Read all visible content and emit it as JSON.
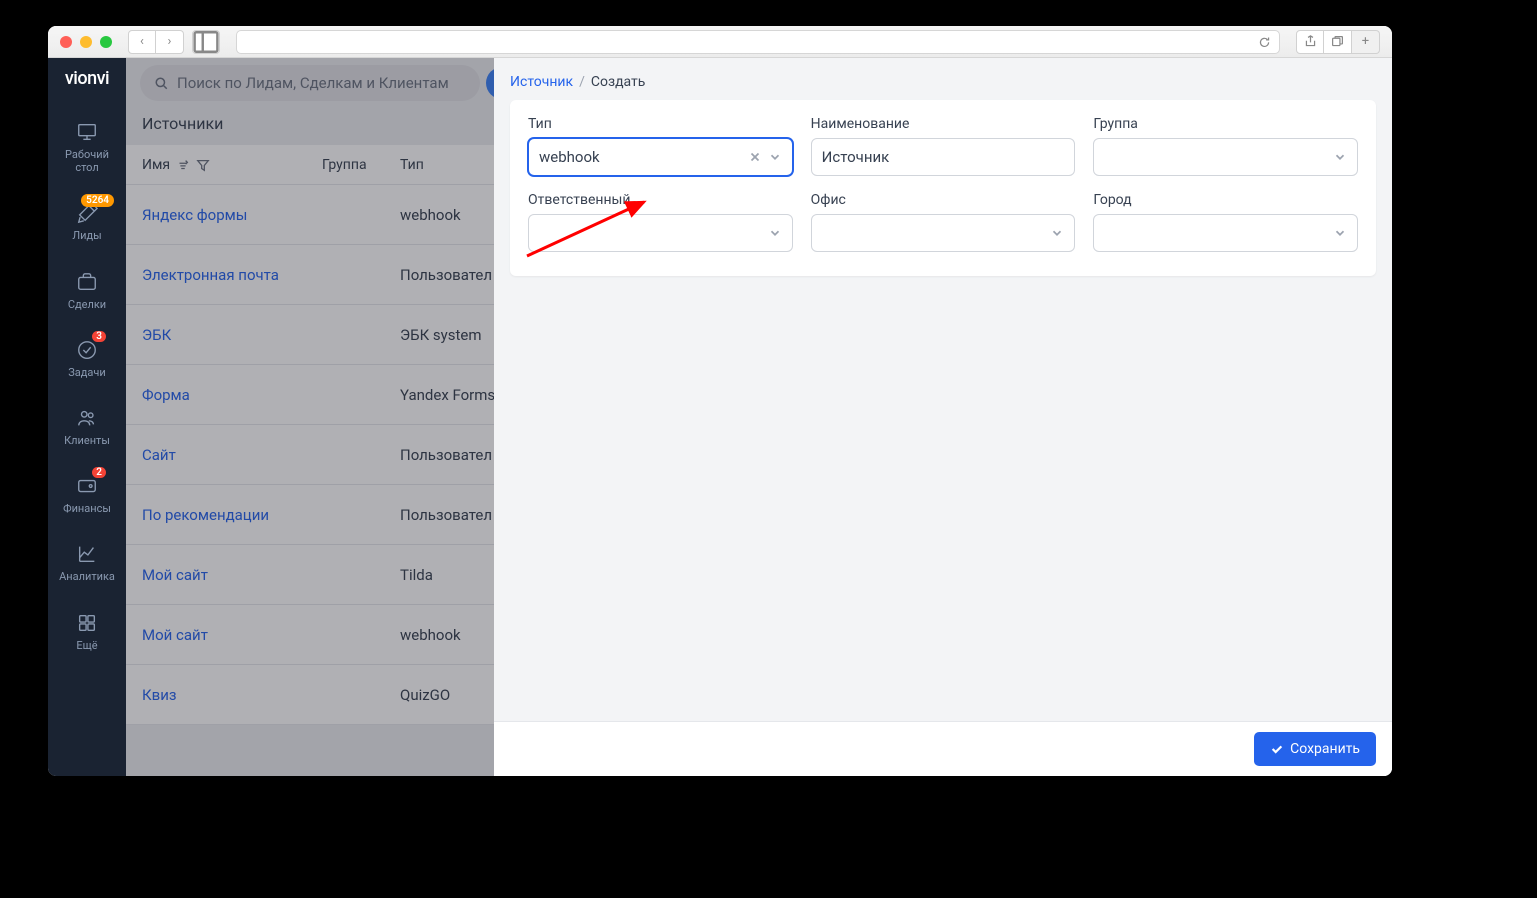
{
  "brand": "vionvi",
  "sidebar": [
    {
      "label": "Рабочий\nстол",
      "badge": null
    },
    {
      "label": "Лиды",
      "badge": "5264",
      "badge_color": "orange"
    },
    {
      "label": "Сделки",
      "badge": null
    },
    {
      "label": "Задачи",
      "badge": "3",
      "badge_color": "red"
    },
    {
      "label": "Клиенты",
      "badge": null
    },
    {
      "label": "Финансы",
      "badge": "2",
      "badge_color": "red"
    },
    {
      "label": "Аналитика",
      "badge": null
    },
    {
      "label": "Ещё",
      "badge": null
    }
  ],
  "search_placeholder": "Поиск по Лидам, Сделкам и Клиентам",
  "page_title": "Источники",
  "columns": {
    "name": "Имя",
    "group": "Группа",
    "type": "Тип"
  },
  "rows": [
    {
      "name": "Яндекс формы",
      "group": "",
      "type": "webhook"
    },
    {
      "name": "Электронная почта",
      "group": "",
      "type": "Пользовател"
    },
    {
      "name": "ЭБК",
      "group": "",
      "type": "ЭБК system"
    },
    {
      "name": "Форма",
      "group": "",
      "type": "Yandex Forms"
    },
    {
      "name": "Сайт",
      "group": "",
      "type": "Пользовател"
    },
    {
      "name": "По рекомендации",
      "group": "",
      "type": "Пользовател"
    },
    {
      "name": "Мой сайт",
      "group": "",
      "type": "Tilda"
    },
    {
      "name": "Мой сайт",
      "group": "",
      "type": "webhook"
    },
    {
      "name": "Квиз",
      "group": "",
      "type": "QuizGO"
    }
  ],
  "breadcrumb": {
    "root": "Источник",
    "current": "Создать"
  },
  "form": {
    "type": {
      "label": "Тип",
      "value": "webhook"
    },
    "name": {
      "label": "Наименование",
      "value": "Источник"
    },
    "group": {
      "label": "Группа",
      "value": ""
    },
    "responsible": {
      "label": "Ответственный",
      "value": ""
    },
    "office": {
      "label": "Офис",
      "value": ""
    },
    "city": {
      "label": "Город",
      "value": ""
    }
  },
  "save_label": "Сохранить"
}
